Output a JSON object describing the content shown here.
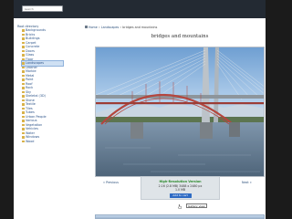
{
  "search": {
    "placeholder": "Search"
  },
  "sidebar": {
    "root_label": "Root directory",
    "items": [
      {
        "label": "Backgrounds",
        "active": false
      },
      {
        "label": "Bricks",
        "active": false
      },
      {
        "label": "Buildings",
        "active": false
      },
      {
        "label": "Carpet",
        "active": false
      },
      {
        "label": "Concrete",
        "active": false
      },
      {
        "label": "Doors",
        "active": false
      },
      {
        "label": "Glass",
        "active": false
      },
      {
        "label": "Floor",
        "active": false
      },
      {
        "label": "Landscapes",
        "active": true
      },
      {
        "label": "Leather",
        "active": false
      },
      {
        "label": "Marble",
        "active": false
      },
      {
        "label": "Metal",
        "active": false
      },
      {
        "label": "Paint",
        "active": false
      },
      {
        "label": "Roof",
        "active": false
      },
      {
        "label": "Rock",
        "active": false
      },
      {
        "label": "Sky",
        "active": false
      },
      {
        "label": "Skeletal (3D)",
        "active": false
      },
      {
        "label": "Stone",
        "active": false
      },
      {
        "label": "Textile",
        "active": false
      },
      {
        "label": "Tiles",
        "active": false
      },
      {
        "label": "Tubes",
        "active": false
      },
      {
        "label": "Urban People",
        "active": false
      },
      {
        "label": "Various",
        "active": false
      },
      {
        "label": "Vegetation",
        "active": false
      },
      {
        "label": "Vehicles",
        "active": false
      },
      {
        "label": "Water",
        "active": false
      },
      {
        "label": "Windows",
        "active": false
      },
      {
        "label": "Wood",
        "active": false
      }
    ]
  },
  "breadcrumb": {
    "home": "Home",
    "sep1": "»",
    "section": "Landscapes",
    "sep2": "»",
    "current": "bridges and mountains"
  },
  "page": {
    "title": "bridges and mountains"
  },
  "nav": {
    "prev": "« Previous",
    "next": "Next »"
  },
  "download": {
    "title": "High-Resolution Version",
    "details": "2.16 (2.8 MB) 3488 x 2480 px",
    "size": "1.0 MB",
    "button": "Add to cart"
  },
  "gallery_link": {
    "label": "Gallery view"
  },
  "colors": {
    "topbar": "#232a33",
    "link": "#2a4e7a",
    "accent_green": "#2d8a2d",
    "button_blue": "#2e6bc4"
  }
}
